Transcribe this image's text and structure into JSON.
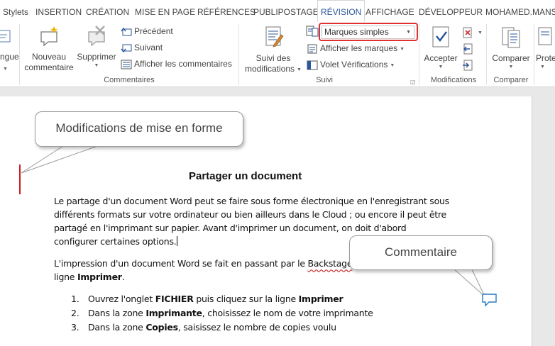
{
  "tabs": [
    {
      "label": "Stylets",
      "active": false
    },
    {
      "label": "INSERTION",
      "active": false
    },
    {
      "label": "CRÉATION",
      "active": false
    },
    {
      "label": "MISE EN PAGE",
      "active": false
    },
    {
      "label": "RÉFÉRENCES",
      "active": false
    },
    {
      "label": "PUBLIPOSTAGE",
      "active": false
    },
    {
      "label": "RÉVISION",
      "active": true
    },
    {
      "label": "AFFICHAGE",
      "active": false
    },
    {
      "label": "DÉVELOPPEUR",
      "active": false
    }
  ],
  "user_name": "MOHAMED.MANS",
  "ribbon": {
    "langue_label": "ngue",
    "nouveau_commentaire": [
      "Nouveau",
      "commentaire"
    ],
    "supprimer": "Supprimer",
    "precedent": "Précédent",
    "suivant": "Suivant",
    "afficher_commentaires": "Afficher les commentaires",
    "group_commentaires": "Commentaires",
    "suivi_modifications": [
      "Suivi des",
      "modifications"
    ],
    "markup_select": "Marques simples",
    "afficher_marques": "Afficher les marques",
    "volet_verifications": "Volet Vérifications",
    "group_suivi": "Suivi",
    "accepter": "Accepter",
    "group_modifications": "Modifications",
    "comparer": "Comparer",
    "group_comparer": "Comparer",
    "proteger": "Prote"
  },
  "document": {
    "title": "Partager un document",
    "para1": [
      "Le partage d'un document Word peut se faire sous forme électronique en l'enregistrant sous",
      "différents formats sur votre ordinateur ou bien ailleurs dans le Cloud ; ou encore il peut être",
      "partagé en l'imprimant sur papier. Avant d'imprimer un document, on doit d'abord",
      "configurer certaines options."
    ],
    "para2_start": "L'impression d'un document Word se fait en passant par le ",
    "para2_backstage": "Backstage",
    "para2_line2_pre": "ligne ",
    "para2_line2_bold": "Imprimer",
    "para2_line2_post": ".",
    "list": [
      {
        "num": "1.",
        "pre": "Ouvrez l'onglet ",
        "b1": "FICHIER",
        "mid": " puis cliquez sur la ligne ",
        "b2": "Imprimer",
        "post": ""
      },
      {
        "num": "2.",
        "pre": "Dans la zone ",
        "b1": "Imprimante",
        "mid": ", choisissez le nom de votre imprimante",
        "b2": "",
        "post": ""
      },
      {
        "num": "3.",
        "pre": "Dans la zone ",
        "b1": "Copies",
        "mid": ", saisissez le nombre de copies voulu",
        "b2": "",
        "post": ""
      }
    ]
  },
  "callouts": {
    "format_changes": "Modifications de mise en forme",
    "comment": "Commentaire"
  },
  "colors": {
    "accent": "#2b579a",
    "highlight": "#e03030",
    "change_bar": "#c81e1e"
  }
}
